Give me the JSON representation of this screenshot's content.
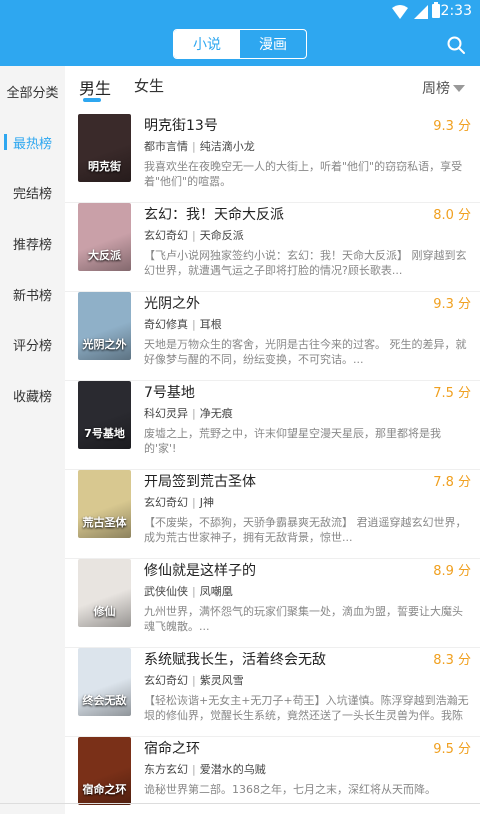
{
  "status_bar": {
    "time": "2:33"
  },
  "header": {
    "tabs": [
      "小说",
      "漫画"
    ],
    "active_tab": 0
  },
  "sidebar": {
    "items": [
      "全部分类",
      "最热榜",
      "完结榜",
      "推荐榜",
      "新书榜",
      "评分榜",
      "收藏榜"
    ],
    "active_index": 1
  },
  "gender_tabs": [
    "男生",
    "女生"
  ],
  "rank_select": "周榜",
  "books": [
    {
      "title": "明克街13号",
      "score": "9.3 分",
      "category": "都市言情",
      "author": "纯洁滴小龙",
      "desc": "我喜欢坐在夜晚空无一人的大街上，听着\"他们\"的窃窃私语，享受着\"他们\"的喧嚣。",
      "cover_text": "明克街",
      "cover_color": "#3a2a2a"
    },
    {
      "title": "玄幻：我！天命大反派",
      "score": "8.0 分",
      "category": "玄幻奇幻",
      "author": "天命反派",
      "desc": "【飞卢小说网独家签约小说：玄幻：我！天命大反派】 刚穿越到玄幻世界，就遭遇气运之子即将打脸的情况?顾长歌表...",
      "cover_text": "大反派",
      "cover_color": "#c9a0a8"
    },
    {
      "title": "光阴之外",
      "score": "9.3 分",
      "category": "奇幻修真",
      "author": "耳根",
      "desc": "天地是万物众生的客舍，光阴是古往今来的过客。 死生的差异，就好像梦与醒的不同，纷纭变换，不可究诘。...",
      "cover_text": "光阴之外",
      "cover_color": "#8fb0c8"
    },
    {
      "title": "7号基地",
      "score": "7.5 分",
      "category": "科幻灵异",
      "author": "净无痕",
      "desc": "废墟之上，荒野之中，许末仰望星空漫天星辰，那里都将是我的'家'!",
      "cover_text": "7号基地",
      "cover_color": "#2a2a30"
    },
    {
      "title": "开局签到荒古圣体",
      "score": "7.8 分",
      "category": "玄幻奇幻",
      "author": "J神",
      "desc": "【不废柴，不舔狗，天骄争霸暴爽无敌流】 君逍遥穿越玄幻世界，成为荒古世家神子，拥有无敌背景，惊世...",
      "cover_text": "荒古圣体",
      "cover_color": "#d8c890"
    },
    {
      "title": "修仙就是这样子的",
      "score": "8.9 分",
      "category": "武侠仙侠",
      "author": "凤嘲凰",
      "desc": "九州世界，满怀怨气的玩家们聚集一处，滴血为盟，誓要让大魔头魂飞魄散。...",
      "cover_text": "修仙",
      "cover_color": "#e8e4e0"
    },
    {
      "title": "系统赋我长生，活着终会无敌",
      "score": "8.3 分",
      "category": "玄幻奇幻",
      "author": "紫灵风雪",
      "desc": "【轻松诙谐+无女主+无刀子+苟王】入坑谨慎。陈浮穿越到浩瀚无垠的修仙界，觉醒长生系统，竟然还送了一头长生灵兽为伴。我陈浮对...",
      "cover_text": "终会无敌",
      "cover_color": "#dce4ec"
    },
    {
      "title": "宿命之环",
      "score": "9.5 分",
      "category": "东方玄幻",
      "author": "爱潜水的乌贼",
      "desc": "诡秘世界第二部。1368之年，七月之末，深红将从天而降。",
      "cover_text": "宿命之环",
      "cover_color": "#7a3018"
    }
  ]
}
